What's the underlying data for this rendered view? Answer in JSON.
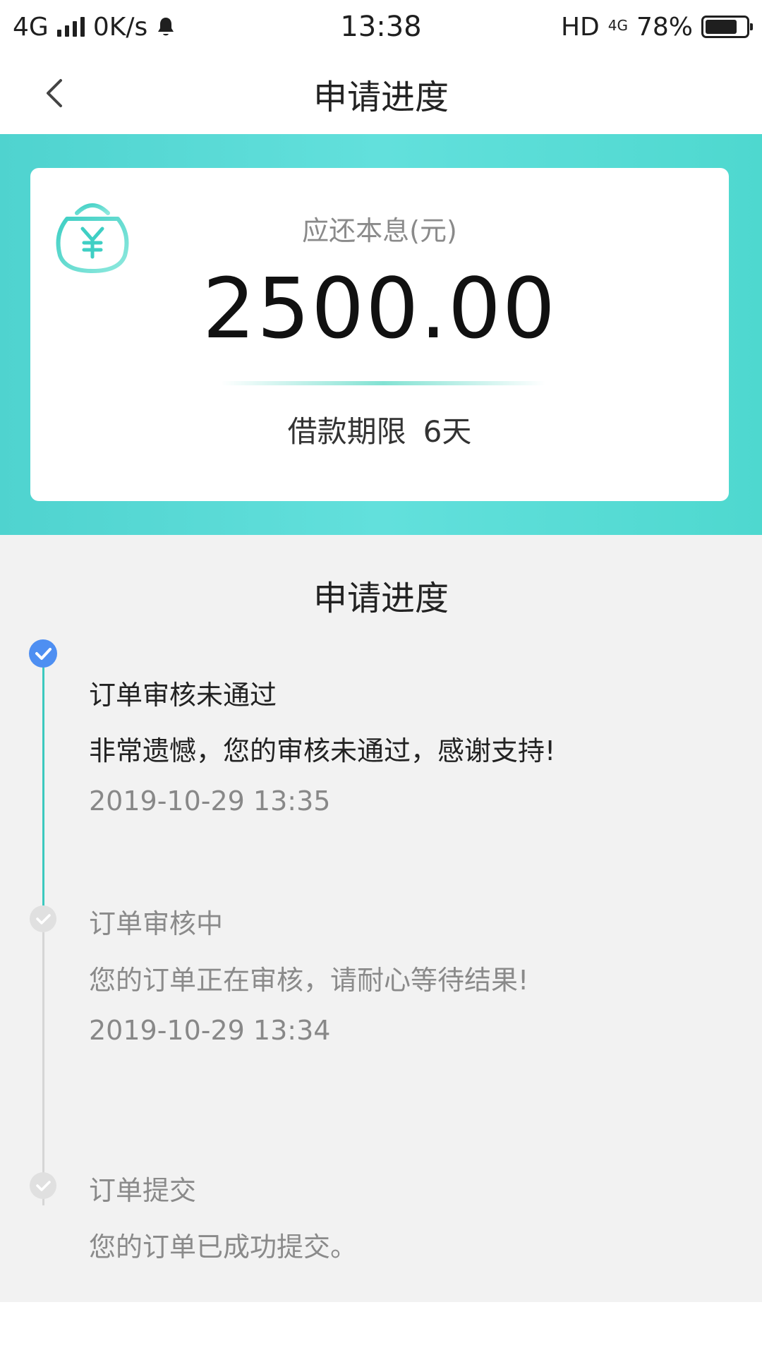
{
  "status_bar": {
    "network": "4G",
    "speed": "0K/s",
    "time": "13:38",
    "hd": "HD",
    "network_right": "4G",
    "battery": "78%",
    "battery_level": 0.78
  },
  "nav": {
    "title": "申请进度"
  },
  "summary": {
    "label": "应还本息(元)",
    "amount": "2500.00",
    "term_label": "借款期限",
    "term_value": "6天"
  },
  "progress": {
    "title": "申请进度",
    "steps": [
      {
        "title": "订单审核未通过",
        "desc": "非常遗憾，您的审核未通过，感谢支持!",
        "time": "2019-10-29 13:35",
        "state": "active"
      },
      {
        "title": "订单审核中",
        "desc": "您的订单正在审核，请耐心等待结果!",
        "time": "2019-10-29 13:34",
        "state": "done"
      },
      {
        "title": "订单提交",
        "desc": "您的订单已成功提交。",
        "state": "done"
      }
    ]
  },
  "colors": {
    "accent": "#4fd3cf",
    "active_dot": "#4e8ff2",
    "timeline_active": "#3cc9bf",
    "timeline_rest": "#d6d6d6",
    "background": "#f2f2f2"
  }
}
